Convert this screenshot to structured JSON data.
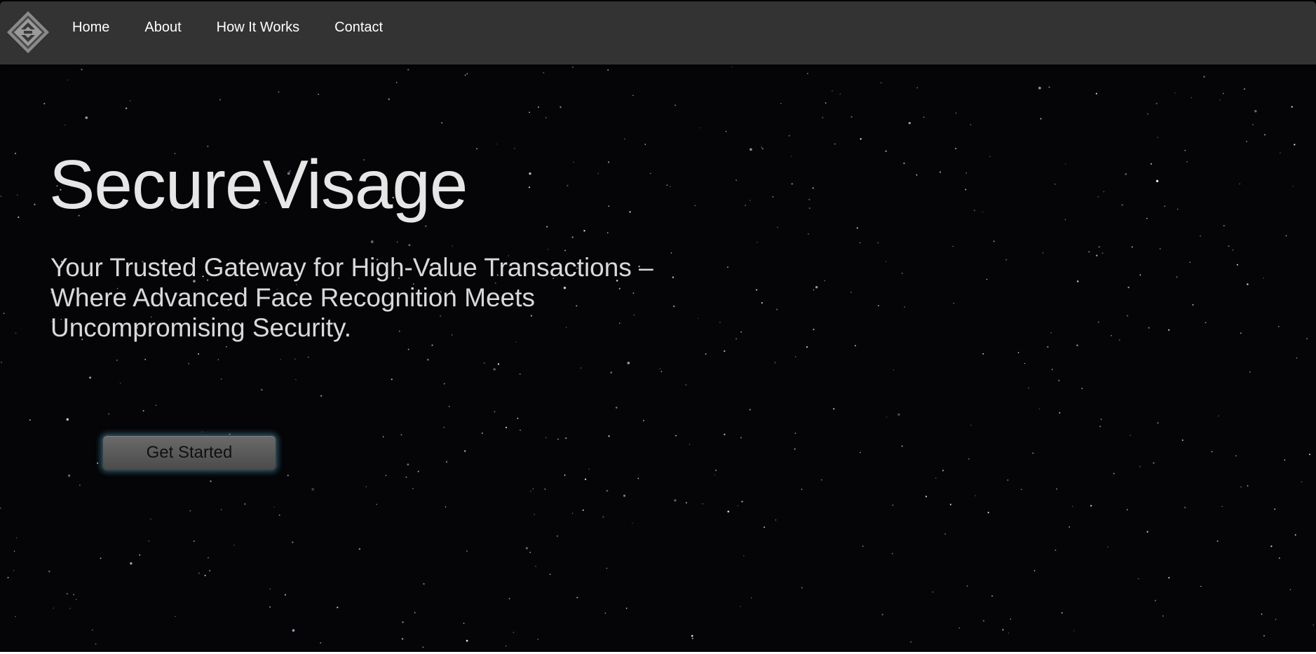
{
  "nav": {
    "logo_icon": "diamond-logo-icon",
    "links": [
      "Home",
      "About",
      "How It Works",
      "Contact"
    ]
  },
  "hero": {
    "title": "SecureVisage",
    "subtitle": "Your Trusted Gateway for High-Value Transactions – Where Advanced Face Recognition Meets Uncompromising Security.",
    "cta_label": "Get Started"
  },
  "colors": {
    "navbar_bg": "#333333",
    "page_bg": "#050407",
    "title_text": "#e6e6e6",
    "button_glow": "#3c8ca0"
  }
}
